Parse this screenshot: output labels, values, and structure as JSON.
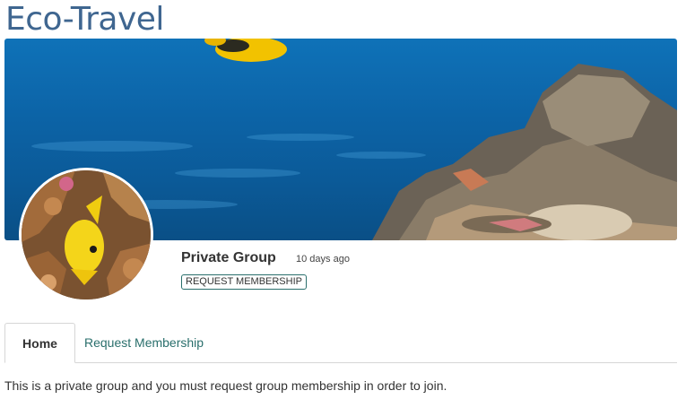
{
  "group": {
    "name": "Eco-Travel",
    "type": "Private Group",
    "age": "10 days ago",
    "membership_badge": "REQUEST MEMBERSHIP",
    "description": "This is a private group and you must request group membership in order to join."
  },
  "tabs": [
    {
      "label": "Home",
      "active": true
    },
    {
      "label": "Request Membership",
      "active": false
    }
  ],
  "colors": {
    "title": "#3f6690",
    "link": "#2a6f6c",
    "banner_water": "#0c63a6"
  },
  "images": {
    "banner": "underwater-coral-reef-photo",
    "avatar": "yellow-fish-on-coral-photo"
  }
}
